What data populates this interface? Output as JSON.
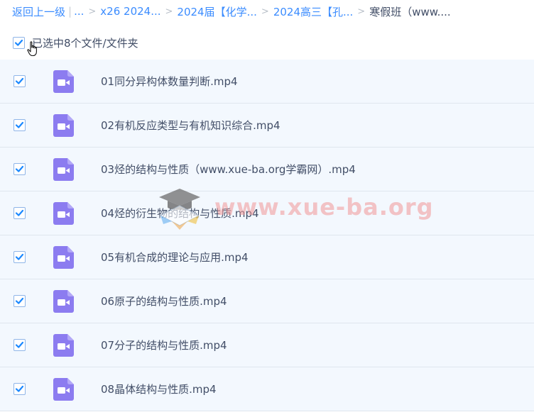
{
  "breadcrumb": {
    "back": "返回上一级",
    "ellipsis": "...",
    "items": [
      "x26 2024...",
      "2024届【化学...",
      "2024高三【孔..."
    ],
    "current": "寒假班（www...."
  },
  "selection": {
    "label": "已选中8个文件/文件夹",
    "checked": true
  },
  "files": [
    {
      "name": "01同分异构体数量判断.mp4",
      "checked": true,
      "icon": "video-file-icon"
    },
    {
      "name": "02有机反应类型与有机知识综合.mp4",
      "checked": true,
      "icon": "video-file-icon"
    },
    {
      "name": "03烃的结构与性质（www.xue-ba.org学霸网）.mp4",
      "checked": true,
      "icon": "video-file-icon"
    },
    {
      "name": "04烃的衍生物的结构与性质.mp4",
      "checked": true,
      "icon": "video-file-icon"
    },
    {
      "name": "05有机合成的理论与应用.mp4",
      "checked": true,
      "icon": "video-file-icon"
    },
    {
      "name": "06原子的结构与性质.mp4",
      "checked": true,
      "icon": "video-file-icon"
    },
    {
      "name": "07分子的结构与性质.mp4",
      "checked": true,
      "icon": "video-file-icon"
    },
    {
      "name": "08晶体结构与性质.mp4",
      "checked": true,
      "icon": "video-file-icon"
    }
  ],
  "watermark": {
    "text": "www.xue-ba.org"
  },
  "colors": {
    "link": "#3b8cff",
    "text": "#424e67",
    "row_bg": "#f3f8fe",
    "row_border": "#dfe6ee",
    "video_icon": "#8c7cf0",
    "check": "#1a88ff"
  }
}
